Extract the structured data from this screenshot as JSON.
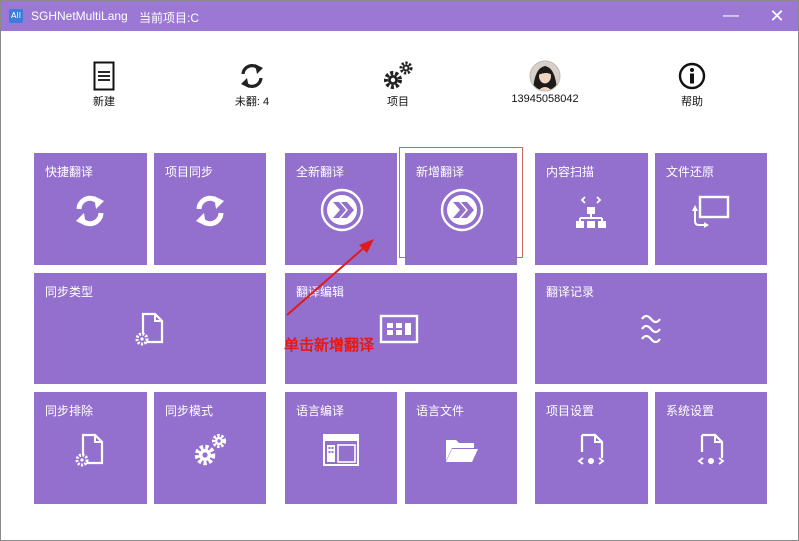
{
  "titlebar": {
    "app_icon_text": "All",
    "app_name": "SGHNetMultiLang",
    "project": "当前项目:C",
    "minimize_glyph": "—",
    "close_glyph": "✕"
  },
  "toolbar": [
    {
      "label": "新建",
      "icon": "document-icon"
    },
    {
      "label": "未翻: 4",
      "icon": "refresh-icon"
    },
    {
      "label": "项目",
      "icon": "gear-icon"
    },
    {
      "label": "13945058042",
      "icon": "avatar"
    },
    {
      "label": "帮助",
      "icon": "info-icon"
    }
  ],
  "tiles": {
    "quick_translate": "快捷翻译",
    "project_sync": "项目同步",
    "full_translate": "全新翻译",
    "incremental_translate": "新增翻译",
    "content_scan": "内容扫描",
    "file_restore": "文件还原",
    "sync_type": "同步类型",
    "translate_edit": "翻译编辑",
    "translate_log": "翻译记录",
    "sync_exclude": "同步排除",
    "sync_mode": "同步模式",
    "language_compile": "语言编译",
    "language_file": "语言文件",
    "project_settings": "项目设置",
    "system_settings": "系统设置"
  },
  "annotation": "单击新增翻译",
  "colors": {
    "titlebar": "#9a78d4",
    "tile": "#9370cd",
    "highlight": "#d0645e",
    "annotation": "#e11a1a"
  }
}
